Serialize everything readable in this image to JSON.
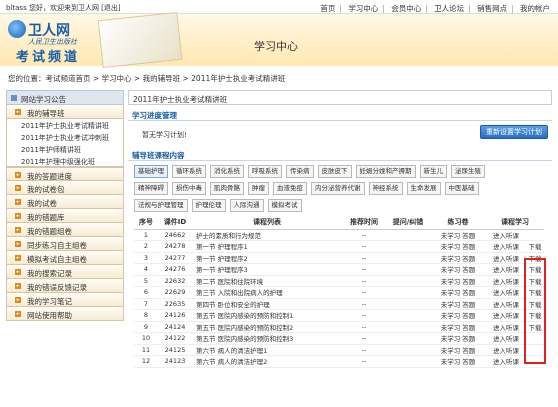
{
  "topbar": {
    "greeting": "bltass 您好，欢迎来到卫人网 [退出]",
    "nav": [
      "首页",
      "学习中心",
      "会员中心",
      "卫人论坛",
      "销售网点",
      "我的帐户"
    ]
  },
  "header": {
    "logo_main": "卫人网",
    "logo_sub": "人民卫生出版社",
    "logo_channel": "考试频道",
    "title": "学习中心"
  },
  "breadcrumb": "您的位置：考试频道首页 > 学习中心 > 我的辅导班 > 2011年护士执业考试精讲班",
  "sidebar": {
    "header": "网站学习公告",
    "items": [
      {
        "label": "我的辅导班",
        "sub": [
          "2011年护士执业考试精讲班",
          "2011年护士执业考试冲刺班",
          "2011年护师精讲班",
          "2011年护理中级强化班"
        ]
      },
      {
        "label": "我的答题进度"
      },
      {
        "label": "我的试卷包"
      },
      {
        "label": "我的试卷"
      },
      {
        "label": "我的错题库"
      },
      {
        "label": "我的错题组卷"
      },
      {
        "label": "同步练习自主组卷"
      },
      {
        "label": "模拟考试自主组卷"
      },
      {
        "label": "我的搜索记录"
      },
      {
        "label": "我的错误反馈记录"
      },
      {
        "label": "我的学习笔记"
      },
      {
        "label": "网站使用帮助"
      }
    ]
  },
  "main": {
    "title": "2011年护士执业考试精讲班",
    "plan_section": "学习进度管理",
    "plan_empty": "暂无学习计划!",
    "plan_button": "重新设置学习计划",
    "courses_section": "辅导班课程内容",
    "categories": [
      [
        "基础护理",
        "循环系统",
        "消化系统",
        "呼吸系统",
        "传染病",
        "皮肤皮下",
        "妊娠分娩和产褥期",
        "新生儿",
        "泌尿生殖"
      ],
      [
        "精神障碍",
        "损伤中毒",
        "肌肉骨骼",
        "肿瘤",
        "血液免疫",
        "内分泌营养代谢",
        "神经系统",
        "生命发展",
        "中医基础"
      ],
      [
        "法规与护理管理",
        "护理伦理",
        "人际沟通",
        "模拟考试"
      ]
    ],
    "table": {
      "headers": [
        "序号",
        "课件ID",
        "课程列表",
        "推荐时间",
        "提问/纠错",
        "练习卷",
        "课程学习"
      ],
      "rows": [
        [
          "1",
          "24662",
          "护士的素质和行为规范",
          "--",
          "",
          "未学习 答题",
          "进入听课",
          ""
        ],
        [
          "2",
          "24278",
          "第一节 护理程序1",
          "--",
          "",
          "未学习 答题",
          "进入听课",
          "下载"
        ],
        [
          "3",
          "24277",
          "第一节 护理程序2",
          "--",
          "",
          "未学习 答题",
          "进入听课",
          "下载"
        ],
        [
          "4",
          "24276",
          "第一节 护理程序3",
          "--",
          "",
          "未学习 答题",
          "进入听课",
          "下载"
        ],
        [
          "5",
          "22632",
          "第二节 医院和住院环境",
          "--",
          "",
          "未学习 答题",
          "进入听课",
          "下载"
        ],
        [
          "6",
          "22629",
          "第三节 入院和出院病人的护理",
          "--",
          "",
          "未学习 答题",
          "进入听课",
          "下载"
        ],
        [
          "7",
          "22635",
          "第四节 卧位和安全的护理",
          "--",
          "",
          "未学习 答题",
          "进入听课",
          "下载"
        ],
        [
          "8",
          "24126",
          "第五节 医院内感染的预防和控制1",
          "--",
          "",
          "未学习 答题",
          "进入听课",
          "下载"
        ],
        [
          "9",
          "24124",
          "第五节 医院内感染的预防和控制2",
          "--",
          "",
          "未学习 答题",
          "进入听课",
          "下载"
        ],
        [
          "10",
          "24122",
          "第五节 医院内感染的预防和控制3",
          "--",
          "",
          "未学习 答题",
          "进入听课",
          ""
        ],
        [
          "11",
          "24125",
          "第六节 病人的清洁护理1",
          "--",
          "",
          "未学习 答题",
          "进入听课",
          ""
        ],
        [
          "12",
          "24123",
          "第六节 病人的清洁护理2",
          "--",
          "",
          "未学习 答题",
          "进入听课",
          ""
        ]
      ]
    }
  }
}
